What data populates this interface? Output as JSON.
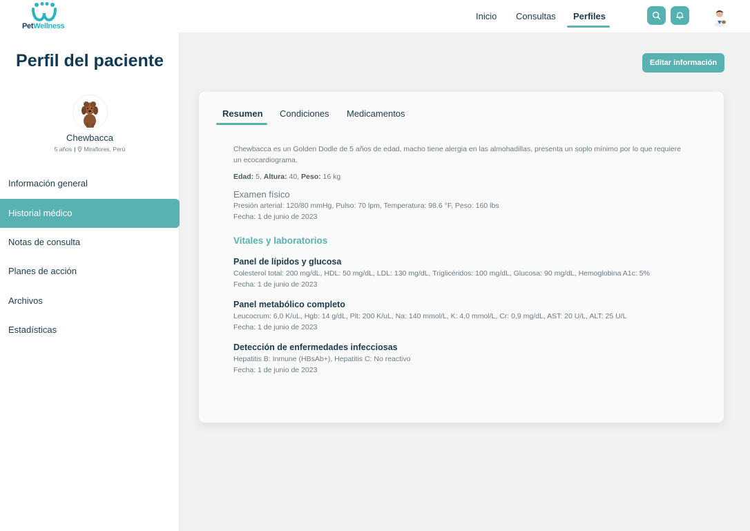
{
  "brand": {
    "name_part1": "Pet",
    "name_part2": "Wellness",
    "logo_icon": "paw-w-logo-icon",
    "accent": "#5ab1b1"
  },
  "nav": {
    "items": [
      {
        "label": "Inicio"
      },
      {
        "label": "Consultas"
      },
      {
        "label": "Perfiles"
      }
    ],
    "active": "Perfiles",
    "search_icon": "search-icon",
    "notification_icon": "bell-icon"
  },
  "sidebar": {
    "title": "Perfil del paciente",
    "pet": {
      "name": "Chewbacca",
      "age": "5 años",
      "separator": "|",
      "location": "Miraflores, Perú"
    },
    "menu": [
      {
        "label": "Información general"
      },
      {
        "label": "Historial médico"
      },
      {
        "label": "Notas de consulta"
      },
      {
        "label": "Planes de acción"
      },
      {
        "label": "Archivos"
      },
      {
        "label": "Estadísticas"
      }
    ],
    "active": "Historial médico"
  },
  "main": {
    "edit_button": "Editar información",
    "tabs": [
      {
        "label": "Resumen"
      },
      {
        "label": "Condiciones"
      },
      {
        "label": "Medicamentos"
      }
    ],
    "active_tab": "Resumen",
    "summary": {
      "description": "Chewbacca es un Golden Dodle de 5 años de edad, macho tiene alergia en las almohadillas, presenta un soplo mínimo por lo que requiere un ecocardiograma.",
      "age_label": "Edad:",
      "age_value": " 5, ",
      "height_label": "Altura:",
      "height_value": " 40, ",
      "weight_label": "Peso:",
      "weight_value": " 16 kg"
    },
    "exam": {
      "title": "Examen físico",
      "values": "Presión arterial: 120/80 mmHg, Pulso: 70 lpm, Temperatura: 98.6 °F, Peso: 160 lbs",
      "date": "Fecha: 1 de junio de 2023"
    },
    "vitals_title": "Vitales y laboratorios",
    "labs": [
      {
        "title": "Panel de lípidos y glucosa",
        "values": "Colesterol total: 200 mg/dL, HDL: 50 mg/dL, LDL: 130 mg/dL, Triglicéridos: 100 mg/dL, Glucosa: 90 mg/dL, Hemoglobina A1c: 5%",
        "date": "Fecha: 1 de junio de 2023"
      },
      {
        "title": "Panel metabólico completo",
        "values": "Leucocrum: 6,0 K/uL, Hgb: 14 g/dL, Plt: 200 K/uL, Na: 140 mmol/L, K: 4,0 mmol/L, Cr: 0,9 mg/dL, AST: 20 U/L, ALT: 25 U/L",
        "date": "Fecha: 1 de junio de 2023"
      },
      {
        "title": "Detección de enfermedades infecciosas",
        "values": "Hepatitis B: Inmune (HBsAb+), Hepatitis C: No reactivo",
        "date": "Fecha: 1 de junio de 2023"
      }
    ]
  }
}
